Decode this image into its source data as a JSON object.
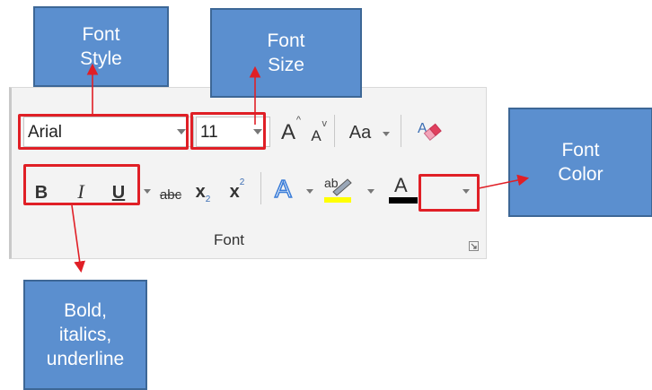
{
  "ribbon": {
    "group_label": "Font",
    "font_name": "Arial",
    "font_size": "11",
    "grow_label": "A",
    "shrink_label": "A",
    "change_case_label": "Aa",
    "bold_label": "B",
    "italic_label": "I",
    "underline_label": "U",
    "strikethrough_label": "abc",
    "subscript_label": "x",
    "subscript_mark": "2",
    "superscript_label": "x",
    "superscript_mark": "2",
    "text_effects_label": "A",
    "highlight_label": "ab",
    "font_color_label": "A",
    "highlight_color": "#ffff00",
    "font_color": "#000000"
  },
  "callouts": {
    "font_style": "Font\nStyle",
    "font_size": "Font\nSize",
    "font_color": "Font\nColor",
    "bold_italics_underline": "Bold,\nitalics,\nunderline"
  },
  "colors": {
    "callout_fill": "#5b8fcf",
    "highlight_border": "#e01f26",
    "arrow": "#e01f26"
  }
}
